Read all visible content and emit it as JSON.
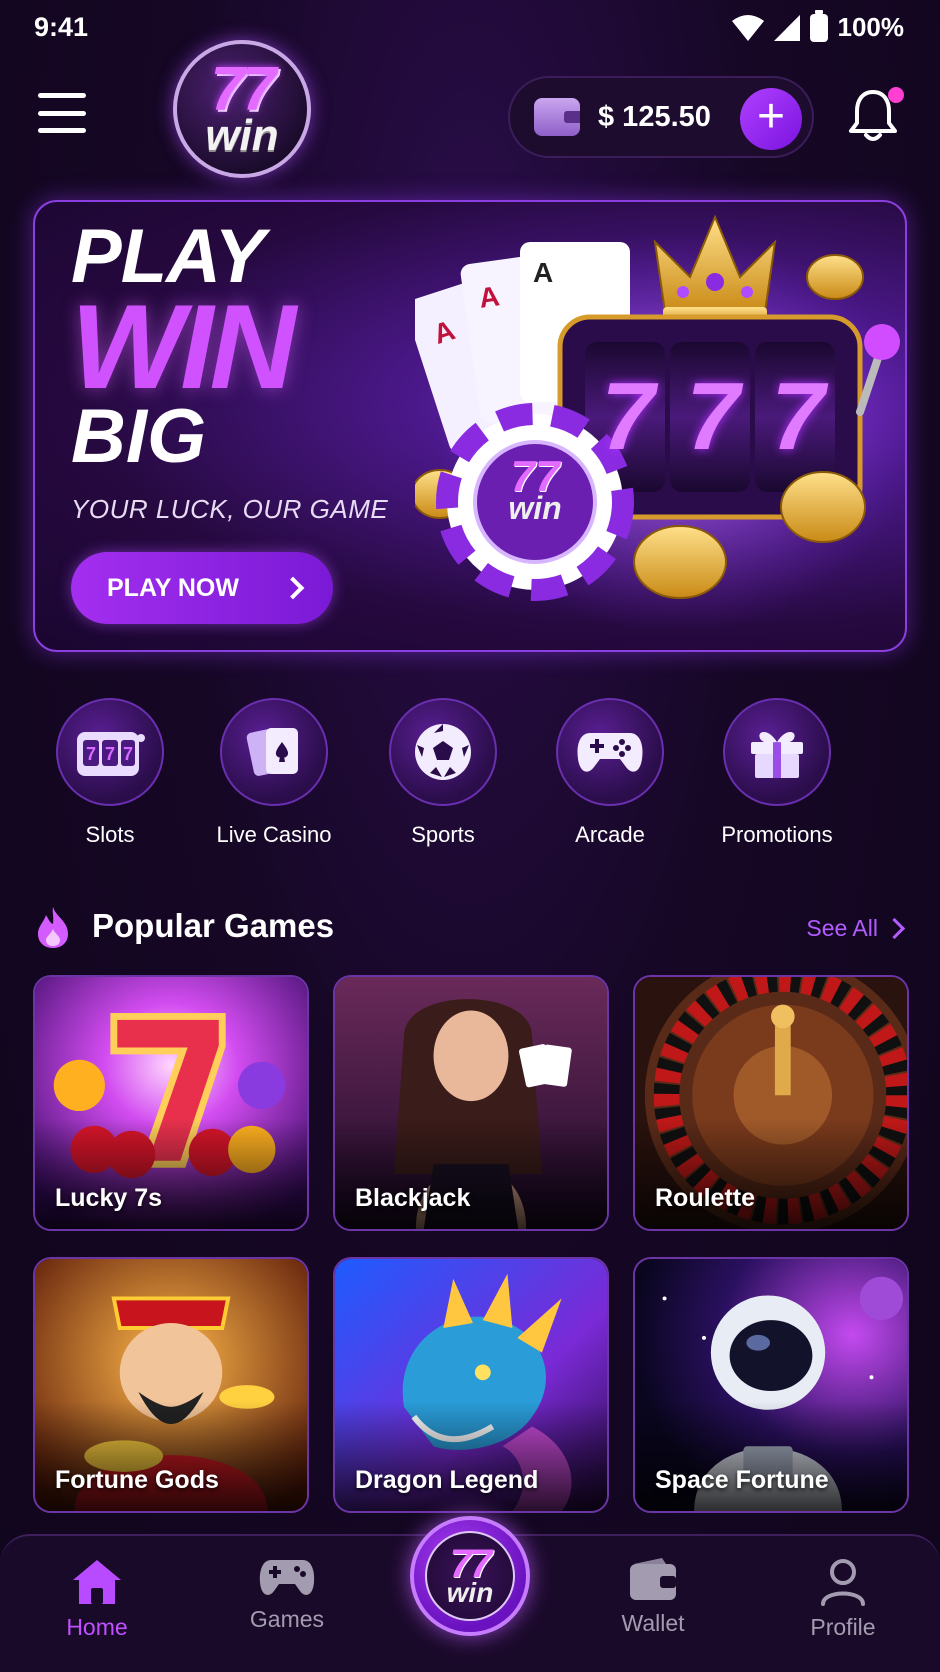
{
  "status_bar": {
    "time": "9:41",
    "battery": "100%"
  },
  "header": {
    "logo": {
      "line1": "77",
      "line2": "win"
    },
    "balance": "$ 125.50"
  },
  "hero": {
    "line1": "PLAY",
    "line2": "WIN",
    "line3": "BIG",
    "tagline": "YOUR LUCK, OUR GAME",
    "cta": "PLAY NOW",
    "reel_digits": [
      "7",
      "7",
      "7"
    ],
    "chip_logo": {
      "line1": "77",
      "line2": "win"
    }
  },
  "categories": [
    {
      "label": "Slots",
      "icon": "slot-machine-icon"
    },
    {
      "label": "Live Casino",
      "icon": "playing-cards-icon"
    },
    {
      "label": "Sports",
      "icon": "soccer-ball-icon"
    },
    {
      "label": "Arcade",
      "icon": "gamepad-icon"
    },
    {
      "label": "Promotions",
      "icon": "gift-icon"
    }
  ],
  "popular": {
    "title": "Popular Games",
    "see_all": "See All",
    "games": [
      {
        "label": "Lucky 7s"
      },
      {
        "label": "Blackjack"
      },
      {
        "label": "Roulette"
      },
      {
        "label": "Fortune Gods"
      },
      {
        "label": "Dragon Legend"
      },
      {
        "label": "Space Fortune"
      }
    ]
  },
  "bottom_nav": {
    "items": [
      {
        "label": "Home",
        "icon": "home-icon",
        "active": true
      },
      {
        "label": "Games",
        "icon": "gamepad-icon",
        "active": false
      },
      {
        "label": "Wallet",
        "icon": "wallet-icon",
        "active": false
      },
      {
        "label": "Profile",
        "icon": "profile-icon",
        "active": false
      }
    ],
    "center_logo": {
      "line1": "77",
      "line2": "win"
    }
  },
  "colors": {
    "accent": "#b040ff",
    "background": "#160725",
    "active_nav": "#c050ff",
    "notification_dot": "#ff3fd2"
  }
}
